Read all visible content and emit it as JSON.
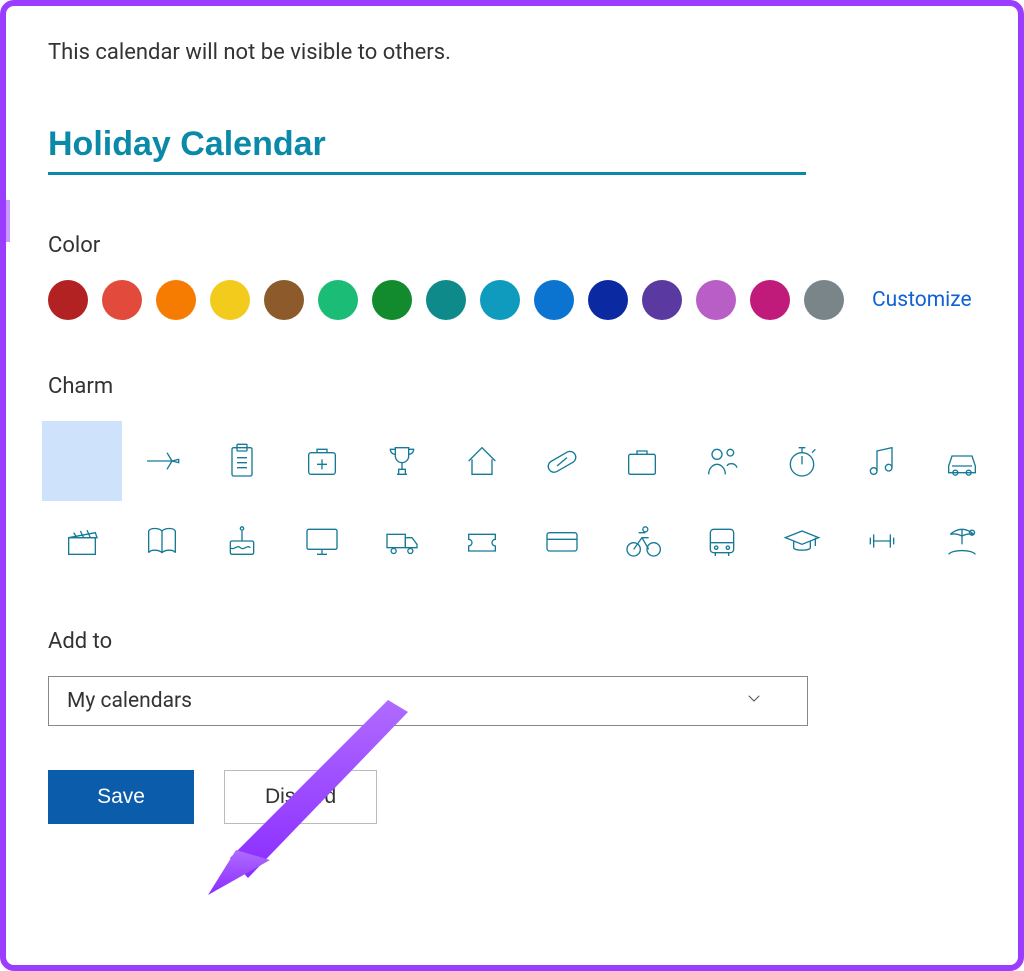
{
  "notice": "This calendar will not be visible to others.",
  "calendar_name": "Holiday Calendar",
  "sections": {
    "color_label": "Color",
    "charm_label": "Charm",
    "addto_label": "Add to"
  },
  "colors": [
    "#b22222",
    "#e24b3b",
    "#f57c00",
    "#f2cb1d",
    "#8d5a2b",
    "#1abc76",
    "#128a2e",
    "#0f8a8a",
    "#0e9bbd",
    "#0b74d1",
    "#0b2aa1",
    "#5a3aa0",
    "#b85ec6",
    "#c01b7a",
    "#7a858a"
  ],
  "customize_label": "Customize",
  "charms": [
    {
      "name": "none",
      "selected": true
    },
    {
      "name": "plane"
    },
    {
      "name": "clipboard"
    },
    {
      "name": "firstaid"
    },
    {
      "name": "trophy"
    },
    {
      "name": "home"
    },
    {
      "name": "pill"
    },
    {
      "name": "briefcase"
    },
    {
      "name": "people"
    },
    {
      "name": "stopwatch"
    },
    {
      "name": "music"
    },
    {
      "name": "car"
    },
    {
      "name": "clapper"
    },
    {
      "name": "book"
    },
    {
      "name": "cake"
    },
    {
      "name": "monitor"
    },
    {
      "name": "truck"
    },
    {
      "name": "ticket"
    },
    {
      "name": "card"
    },
    {
      "name": "bike"
    },
    {
      "name": "bus"
    },
    {
      "name": "grad"
    },
    {
      "name": "dumbbell"
    },
    {
      "name": "beach"
    }
  ],
  "addto_value": "My calendars",
  "buttons": {
    "save": "Save",
    "discard": "Discard"
  }
}
